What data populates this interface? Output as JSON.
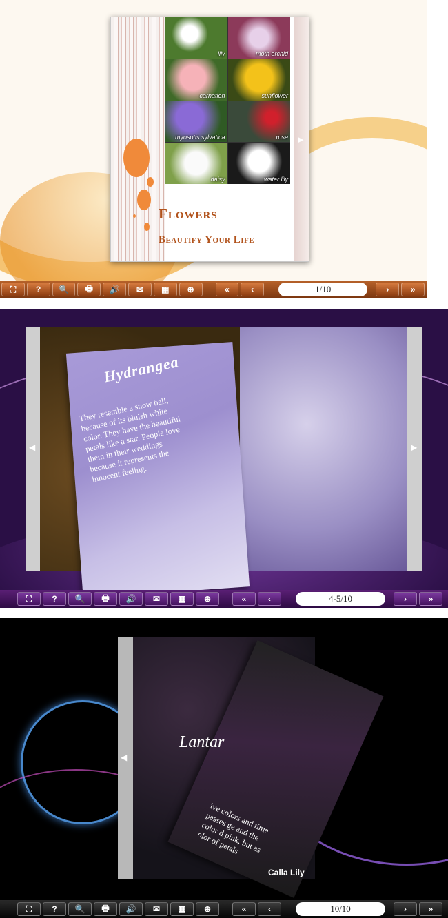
{
  "panel1": {
    "book_title": "Flowers",
    "book_subtitle": "Beautify Your Life",
    "flowers": [
      "lily",
      "moth orchid",
      "carnation",
      "sunflower",
      "myosotis sylvatica",
      "rose",
      "daisy",
      "water lily"
    ],
    "page_indicator": "1/10"
  },
  "panel2": {
    "flower_title": "Hydrangea",
    "flower_text": "They resemble a snow ball, because of its bluish white color. They have the beautiful petals like a star. People love them in their weddings because it represents the innocent feeling.",
    "page_indicator": "4-5/10"
  },
  "panel3": {
    "flower_title": "Lantar",
    "caption": "Calla Lily",
    "partial_text": "ive colors and time passes ge and the color d pink, but as olor of petals",
    "page_indicator": "10/10"
  },
  "toolbar": {
    "icons": [
      "fit-screen-icon",
      "help-icon",
      "search-icon",
      "print-icon",
      "sound-icon",
      "email-icon",
      "thumbnails-icon",
      "zoom-in-icon"
    ],
    "icon_glyphs": [
      "⛶",
      "?",
      "🔍",
      "🖶",
      "🔊",
      "✉",
      "▦",
      "⊕"
    ],
    "nav_glyphs": [
      "«",
      "‹",
      "›",
      "»"
    ]
  },
  "colors": {
    "panel1_accent": "#b2531c",
    "panel2_accent": "#5a1f75",
    "panel3_accent": "#111111"
  }
}
